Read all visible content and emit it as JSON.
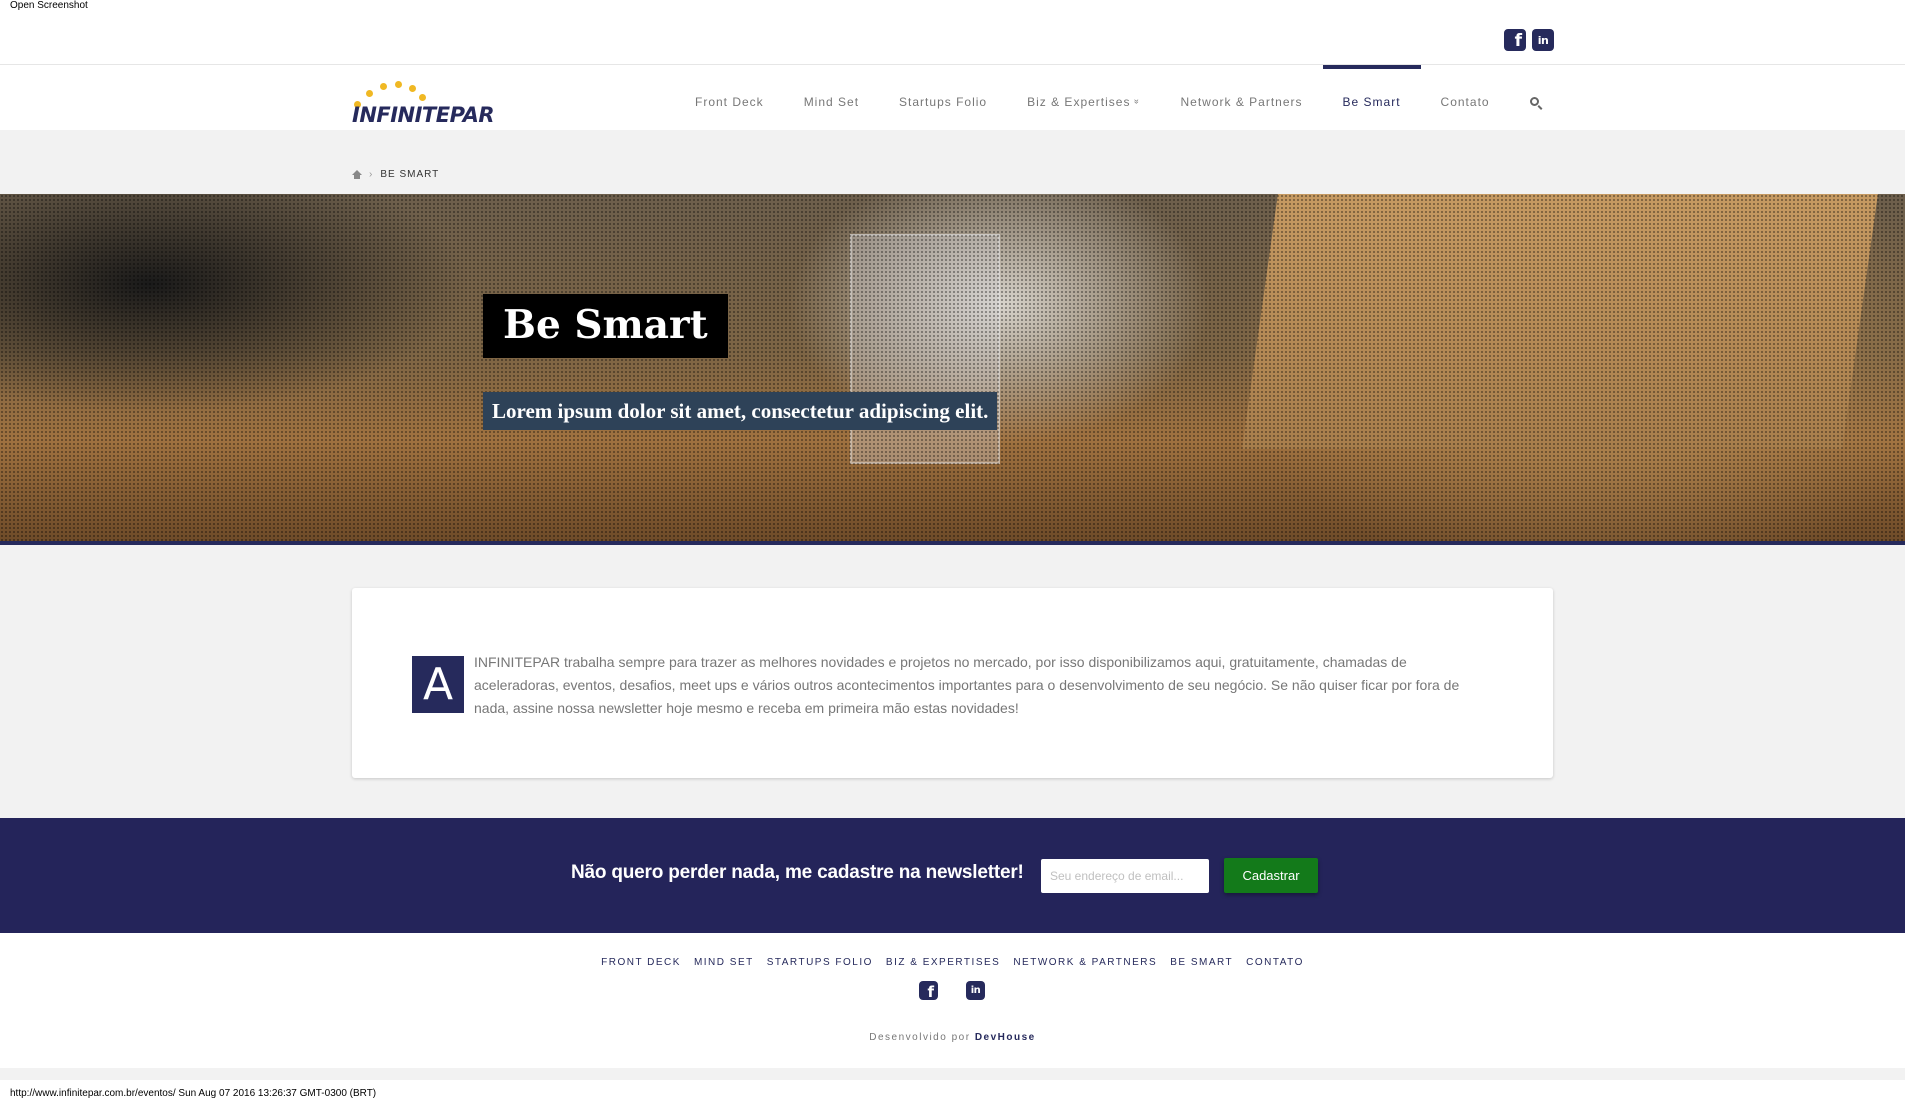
{
  "print": {
    "header": "Open Screenshot",
    "footer": "http://www.infinitepar.com.br/eventos/ Sun Aug 07 2016 13:26:37 GMT-0300 (BRT)"
  },
  "topbar": {
    "social": [
      "facebook-icon",
      "linkedin-icon"
    ],
    "facebook_glyph": "f",
    "linkedin_glyph": "in"
  },
  "logo": {
    "text": "INFINITEPAR",
    "dot_color": "#f0b823",
    "text_color": "#262a5c"
  },
  "nav": {
    "items": [
      {
        "label": "Front Deck"
      },
      {
        "label": "Mind Set"
      },
      {
        "label": "Startups Folio"
      },
      {
        "label": "Biz & Expertises",
        "caret": "»"
      },
      {
        "label": "Network & Partners"
      },
      {
        "label": "Be Smart",
        "active": true
      },
      {
        "label": "Contato"
      }
    ],
    "search_icon": "search-icon"
  },
  "breadcrumb": {
    "home_icon": "home-icon",
    "separator": "›",
    "current": "BE SMART"
  },
  "hero": {
    "title": "Be Smart",
    "subtitle": "Lorem ipsum dolor sit amet, consectetur adipiscing elit."
  },
  "intro": {
    "dropcap": "A",
    "text": "INFINITEPAR trabalha sempre para trazer as melhores novidades e projetos no mercado, por isso disponibilizamos aqui, gratuitamente, chamadas de aceleradoras, eventos, desafios, meet ups e vários outros acontecimentos importantes para o desenvolvimento de seu negócio. Se não quiser ficar por fora de nada, assine nossa newsletter hoje mesmo e receba em primeira mão estas novidades!"
  },
  "newsletter": {
    "title": "Não quero perder nada, me cadastre na newsletter!",
    "email_placeholder": "Seu endereço de email...",
    "submit_label": "Cadastrar"
  },
  "footer": {
    "nav": [
      "FRONT DECK",
      "MIND SET",
      "STARTUPS FOLIO",
      "BIZ & EXPERTISES",
      "NETWORK & PARTNERS",
      "BE SMART",
      "CONTATO"
    ],
    "credit_prefix": "Desenvolvido por",
    "credit_link": "DevHouse"
  },
  "colors": {
    "brand": "#262a5c",
    "button_green": "#137a1a",
    "newsletter_bg": "#24245a"
  }
}
